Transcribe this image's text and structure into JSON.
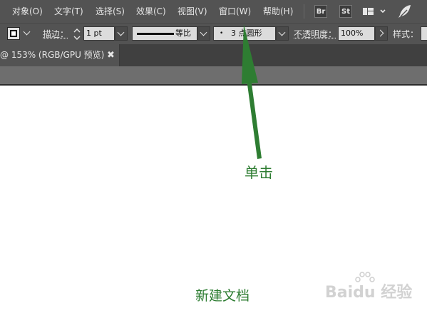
{
  "menubar": {
    "items": [
      "对象(O)",
      "文字(T)",
      "选择(S)",
      "效果(C)",
      "视图(V)",
      "窗口(W)",
      "帮助(H)"
    ],
    "bridge_label": "Br",
    "stock_label": "St"
  },
  "controlbar": {
    "stroke_label": "描边：",
    "stroke_weight": "1 pt",
    "profile_label": "等比",
    "brush_label": "3 点圆形",
    "opacity_label": "不透明度：",
    "opacity_value": "100%",
    "style_label": "样式："
  },
  "tab": {
    "label": "@ 153% (RGB/GPU 预览)",
    "close_glyph": "✖"
  },
  "annotations": {
    "click": "单击",
    "new_doc": "新建文档"
  },
  "watermark": {
    "text": "Baidu 经验"
  }
}
